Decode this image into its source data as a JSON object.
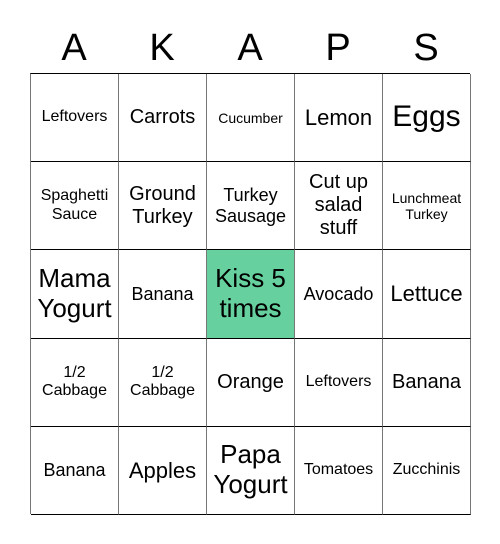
{
  "header": [
    "A",
    "K",
    "A",
    "P",
    "S"
  ],
  "free_color": "#66d19e",
  "cells": [
    [
      "Leftovers",
      "Carrots",
      "Cucumber",
      "Lemon",
      "Eggs"
    ],
    [
      "Spaghetti Sauce",
      "Ground Turkey",
      "Turkey Sausage",
      "Cut up salad stuff",
      "Lunchmeat Turkey"
    ],
    [
      "Mama Yogurt",
      "Banana",
      "Kiss 5 times",
      "Avocado",
      "Lettuce"
    ],
    [
      "1/2 Cabbage",
      "1/2 Cabbage",
      "Orange",
      "Leftovers",
      "Banana"
    ],
    [
      "Banana",
      "Apples",
      "Papa Yogurt",
      "Tomatoes",
      "Zucchinis"
    ]
  ]
}
